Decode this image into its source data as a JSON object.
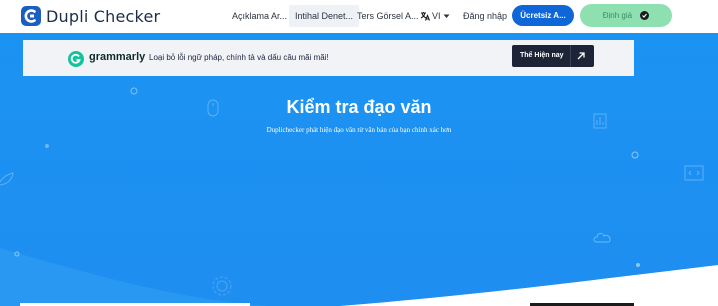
{
  "header": {
    "logo_text": "Dupli Checker",
    "nav": [
      {
        "label": "Açıklama Ar..."
      },
      {
        "label": "Intihal Denet..."
      },
      {
        "label": "Ters Görsel A..."
      }
    ],
    "lang_label": "VI",
    "login_label": "Đăng nhập",
    "cta_label": "Ücretsiz A...",
    "pricing_label": "Định giá"
  },
  "promo": {
    "brand": "grammarly",
    "text": "Loại bỏ lỗi ngữ pháp, chính tả và dấu câu mãi mãi!",
    "button_label": "Thể Hiện nay"
  },
  "hero": {
    "title": "Kiểm tra đạo văn",
    "subtitle": "Duplichecker phát hiện đạo văn từ văn bản của bạn chính xác hơn"
  },
  "colors": {
    "hero_bg": "#1e90f2",
    "primary_button": "#0f66d8",
    "pricing_button": "#8fe0b1",
    "grammarly_green": "#15c39a"
  }
}
